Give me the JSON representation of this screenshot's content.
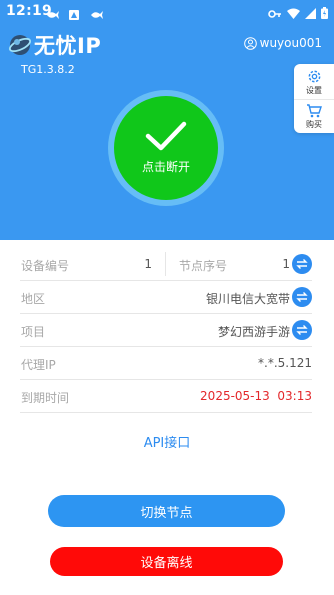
{
  "status_bar": {
    "time": "12:19"
  },
  "app": {
    "name": "无忧IP",
    "version": "TG1.3.8.2"
  },
  "user": {
    "name": "wuyou001"
  },
  "side_menu": {
    "settings_label": "设置",
    "buy_label": "购买"
  },
  "connect": {
    "label": "点击断开",
    "state": "connected"
  },
  "info": {
    "device_no_label": "设备编号",
    "device_no_value": "1",
    "node_no_label": "节点序号",
    "node_no_value": "1",
    "region_label": "地区",
    "region_value": "银川电信大宽带",
    "project_label": "项目",
    "project_value": "梦幻西游手游",
    "proxy_ip_label": "代理IP",
    "proxy_ip_value": "*.*.5.121",
    "expire_label": "到期时间",
    "expire_value": "2025-05-13  03:13"
  },
  "api_link": "API接口",
  "buttons": {
    "switch_node": "切换节点",
    "device_offline": "设备离线"
  },
  "colors": {
    "primary": "#3a98f1",
    "connected": "#10c71a",
    "danger": "#ff0a08",
    "expire": "#e3282b"
  }
}
